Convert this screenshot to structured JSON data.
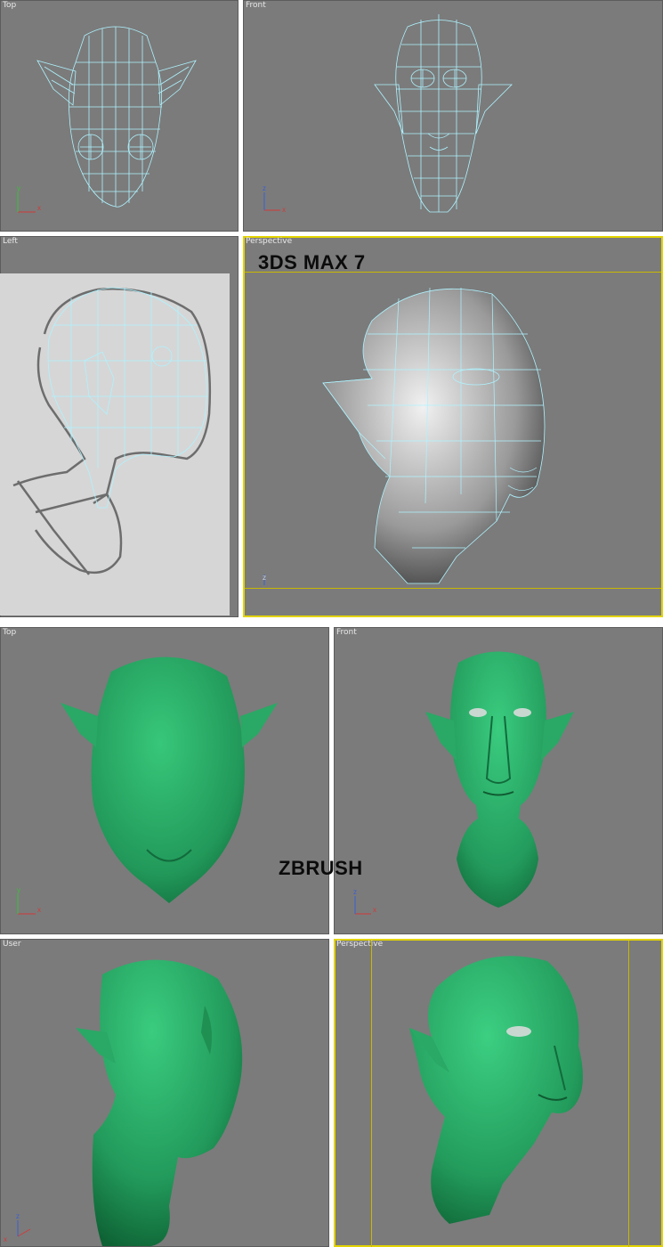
{
  "top_section": {
    "title": "3DS MAX 7",
    "viewports": {
      "top": "Top",
      "front": "Front",
      "left": "Left",
      "perspective": "Perspective"
    }
  },
  "bottom_section": {
    "title": "ZBRUSH",
    "viewports": {
      "top": "Top",
      "front": "Front",
      "user": "User",
      "perspective": "Perspective"
    }
  },
  "axis_labels": {
    "x": "x",
    "y": "y",
    "z": "z"
  },
  "colors": {
    "viewport_bg": "#7b7b7b",
    "wireframe": "#aef3ff",
    "sculpt_green": "#2ea866",
    "active_frame": "#e3d300"
  }
}
